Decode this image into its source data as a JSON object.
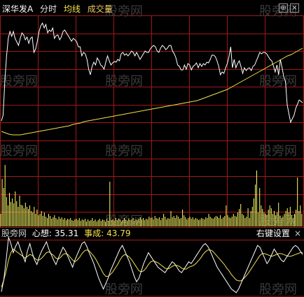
{
  "header": {
    "stock_name": "深华发A",
    "view_mode": "分时",
    "avg_line_label": "均线",
    "volume_label": "成交量",
    "settings_icon": "⊕",
    "close_icon": "×"
  },
  "indicator": {
    "watermark": "股旁网",
    "line1_label": "心想:",
    "line1_value": "35.31",
    "line2_label": "事成:",
    "line2_value": "43.79",
    "settings_label": "右键设置",
    "close_icon": "×"
  },
  "watermark_text": "股旁网",
  "colors": {
    "background": "#000000",
    "grid": "#a01818",
    "price_line": "#ffffff",
    "avg_line": "#f4e04d",
    "volume_bar": "#ffff66",
    "indicator_line1": "#ffffff",
    "indicator_line2": "#f4e04d",
    "watermark": "#3a3a3a"
  },
  "chart_data": {
    "type": "line",
    "price": [
      32,
      40,
      88,
      124,
      150,
      160,
      153,
      160,
      150,
      145,
      140,
      150,
      158,
      155,
      148,
      152,
      143,
      150,
      152,
      130,
      135,
      146,
      160,
      168,
      172,
      165,
      170,
      158,
      162,
      160,
      165,
      150,
      154,
      155,
      148,
      152,
      160,
      162,
      158,
      154,
      150,
      146,
      150,
      148,
      145,
      138,
      138,
      125,
      130,
      128,
      120,
      106,
      98,
      110,
      116,
      112,
      122,
      118,
      112,
      110,
      106,
      116,
      125,
      118,
      112,
      115,
      117,
      116,
      120,
      118,
      128,
      130,
      126,
      128,
      125,
      128,
      132,
      130,
      125,
      130,
      125,
      120,
      124,
      128,
      132,
      130,
      130,
      135,
      138,
      140,
      138,
      132,
      130,
      136,
      140,
      138,
      134,
      136,
      140,
      140,
      132,
      128,
      122,
      112,
      110,
      105,
      105,
      112,
      106,
      114,
      112,
      105,
      110,
      112,
      115,
      108,
      114,
      110,
      114,
      112,
      116,
      115,
      120,
      126,
      126,
      124,
      118,
      110,
      98,
      102,
      100,
      108,
      114,
      124,
      138,
      108,
      120,
      108,
      114,
      118,
      110,
      100,
      108,
      104,
      107,
      108,
      104,
      110,
      112,
      118,
      124,
      130,
      128,
      130,
      130,
      128,
      124,
      120,
      118,
      110,
      102,
      112,
      98,
      120,
      108,
      95,
      88,
      55,
      42,
      30,
      35,
      40,
      50,
      56,
      62,
      60,
      58
    ],
    "avg": [
      142,
      140,
      138,
      137,
      137,
      137,
      138,
      139,
      140,
      141,
      142,
      143,
      144,
      145,
      146,
      147,
      148,
      149,
      150,
      152,
      153,
      154,
      156,
      157,
      158,
      159,
      160,
      161,
      162,
      163,
      164,
      165,
      166,
      167,
      168,
      169,
      170,
      171,
      172,
      173,
      174,
      175,
      176,
      177,
      178,
      179,
      180,
      181,
      182,
      183,
      184,
      185,
      186,
      188,
      190,
      192,
      194,
      196,
      198,
      200,
      202,
      205,
      208,
      211,
      214,
      217,
      220,
      223,
      226,
      229,
      232,
      235,
      238,
      241,
      244,
      247,
      250,
      252,
      255,
      258,
      261
    ],
    "volume": [
      18,
      68,
      55,
      88,
      42,
      30,
      48,
      35,
      40,
      33,
      50,
      36,
      28,
      44,
      31,
      30,
      26,
      34,
      28,
      25,
      30,
      22,
      20,
      28,
      18,
      24,
      16,
      18,
      22,
      15,
      20,
      14,
      12,
      18,
      15,
      11,
      13,
      16,
      12,
      10,
      14,
      11,
      13,
      10,
      12,
      9,
      11,
      10,
      12,
      9,
      8,
      10,
      11,
      9,
      12,
      8,
      10,
      9,
      11,
      7,
      10,
      8,
      9,
      12,
      8,
      10,
      7,
      9,
      11,
      8,
      10,
      9,
      7,
      11,
      8,
      64,
      9,
      10,
      8,
      12,
      9,
      11,
      10,
      7,
      9,
      12,
      10,
      8,
      11,
      9,
      10,
      12,
      8,
      10,
      9,
      11,
      13,
      10,
      12,
      9,
      11,
      10,
      14,
      12,
      13,
      10,
      15,
      12,
      11,
      13,
      9,
      12,
      18,
      14,
      10,
      12,
      11,
      22,
      13,
      15,
      12,
      16,
      14,
      11,
      12,
      24,
      16,
      13,
      10,
      12,
      14,
      11,
      13,
      10,
      12,
      11,
      9,
      10,
      12,
      11,
      10,
      13,
      12,
      18,
      14,
      12,
      11,
      13,
      15,
      14,
      12,
      16,
      11,
      13,
      15,
      30,
      16,
      13,
      12,
      14,
      18,
      15,
      14,
      20,
      25,
      32,
      18,
      16,
      12,
      14,
      26,
      12,
      22,
      28,
      40,
      60,
      80,
      20,
      55,
      30,
      25,
      20,
      18,
      16,
      24,
      30,
      26,
      18,
      22,
      16,
      20,
      34,
      15,
      12,
      14,
      18,
      22,
      26,
      20,
      28,
      16,
      12,
      18,
      24,
      70,
      22,
      30,
      18
    ],
    "indicator_line1": [
      5,
      18,
      40,
      65,
      58,
      48,
      55,
      60,
      52,
      45,
      38,
      50,
      58,
      48,
      40,
      35,
      44,
      50,
      55,
      60,
      52,
      46,
      40,
      35,
      42,
      48,
      54,
      50,
      44,
      38,
      32,
      40,
      46,
      52,
      58,
      60,
      55,
      48,
      42,
      36,
      28,
      20,
      14,
      8,
      14,
      20,
      28,
      34,
      40,
      46,
      52,
      56,
      50,
      44,
      38,
      30,
      22,
      16,
      20,
      28,
      36,
      42,
      48,
      44,
      40,
      36,
      32,
      30,
      28,
      26,
      30,
      34,
      38,
      36,
      32,
      28,
      26,
      30,
      34,
      38,
      36,
      40,
      44,
      48,
      52,
      56,
      58,
      55,
      50,
      44,
      38,
      32,
      28,
      24,
      20,
      16,
      12,
      8,
      6,
      4,
      8,
      14,
      20,
      26,
      32,
      38,
      44,
      50,
      56,
      54,
      48,
      42,
      36,
      40,
      46,
      52,
      48,
      44,
      40,
      38,
      42,
      46,
      50,
      54,
      56,
      54,
      50,
      46
    ],
    "indicator_line2": [
      10,
      18,
      28,
      40,
      48,
      52,
      50,
      48,
      46,
      44,
      42,
      44,
      46,
      45,
      42,
      40,
      40,
      42,
      45,
      48,
      49,
      47,
      45,
      42,
      41,
      43,
      46,
      47,
      46,
      43,
      40,
      38,
      40,
      43,
      47,
      50,
      51,
      50,
      47,
      44,
      40,
      35,
      30,
      25,
      22,
      22,
      24,
      27,
      31,
      35,
      40,
      44,
      46,
      45,
      43,
      40,
      36,
      32,
      28,
      27,
      28,
      31,
      35,
      38,
      39,
      38,
      37,
      35,
      33,
      31,
      30,
      31,
      33,
      34,
      34,
      33,
      31,
      30,
      30,
      32,
      33,
      34,
      36,
      39,
      42,
      46,
      49,
      51,
      51,
      50,
      47,
      44,
      41,
      38,
      35,
      31,
      28,
      24,
      21,
      18,
      17,
      17,
      19,
      22,
      25,
      29,
      33,
      37,
      41,
      45,
      47,
      47,
      46,
      45,
      44,
      45,
      46,
      47,
      47,
      46,
      45,
      44,
      44,
      45,
      46,
      47,
      48,
      48
    ]
  }
}
